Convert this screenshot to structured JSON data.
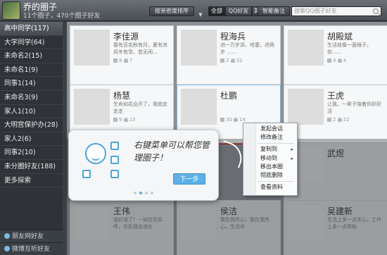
{
  "header": {
    "title": "乔的圈子",
    "subtitle": "11个圈子，470个圈子好友",
    "sort_label": "按亲密度排序",
    "sort_dropdown": "▼",
    "filters": [
      "全部",
      "QQ好友",
      "其他"
    ],
    "remark_label": "智能备注",
    "search_placeholder": "搜索QQ圈子好友"
  },
  "sidebar": {
    "items": [
      {
        "label": "高中同学(117)"
      },
      {
        "label": "大学同学(64)"
      },
      {
        "label": "未命名2(15)"
      },
      {
        "label": "未命名1(9)"
      },
      {
        "label": "同事1(14)"
      },
      {
        "label": "未命名3(9)"
      },
      {
        "label": "家人1(10)"
      },
      {
        "label": "大明宫保护办(28)"
      },
      {
        "label": "家人2(6)"
      },
      {
        "label": "同事2(10)"
      },
      {
        "label": "未分圈好友(188)"
      },
      {
        "label": "更多探索"
      }
    ],
    "footer": [
      "朋友网好友",
      "微博互听好友"
    ]
  },
  "cards": [
    {
      "name": "李佳源",
      "sig": "春有百花秋有月，夏有凉风冬有雪，若无闲...",
      "msgs": "8",
      "friends": "7"
    },
    {
      "name": "程海兵",
      "sig": "进一万步讲，哇塞，进两步 ......",
      "msgs": "2",
      "friends": "32"
    },
    {
      "name": "胡殿斌",
      "sig": "生活就像一面镜子，你……",
      "msgs": "4",
      "friends": "4"
    },
    {
      "name": "杨慧",
      "sig": "生命如花会开了，我就走走走",
      "msgs": "9",
      "friends": "15"
    },
    {
      "name": "杜鹏",
      "sig": "",
      "msgs": "30",
      "friends": "14"
    },
    {
      "name": "王虎",
      "sig": "让我，一辈子陪着你好好活",
      "msgs": "2",
      "friends": "22"
    },
    {
      "name": "武煜",
      "sig": "",
      "msgs": "",
      "friends": ""
    },
    {
      "name": "王伟",
      "sig": "油价涨了！一如往农民呼，农民我去涨价",
      "msgs": "",
      "friends": ""
    },
    {
      "name": "侯洁",
      "sig": "我在我所心，我在我所心，生活中",
      "msgs": "",
      "friends": ""
    },
    {
      "name": "吴建新",
      "sig": "生活上多一点关心，工作上多一点帮助",
      "msgs": "",
      "friends": ""
    }
  ],
  "guide": {
    "text": "右键菜单可以帮您管理圈子！",
    "next_label": "下一步"
  },
  "context_menu": {
    "items": [
      "发起会话",
      "修改备注",
      "复制到",
      "移动到",
      "移出本圈",
      "彻底删除",
      "查看资料"
    ],
    "submenu_arrow": "▸"
  },
  "colors": {
    "accent": "#5cb0e6",
    "sidebar_bg": "#2f3337",
    "grid_bg": "#8c9095"
  }
}
